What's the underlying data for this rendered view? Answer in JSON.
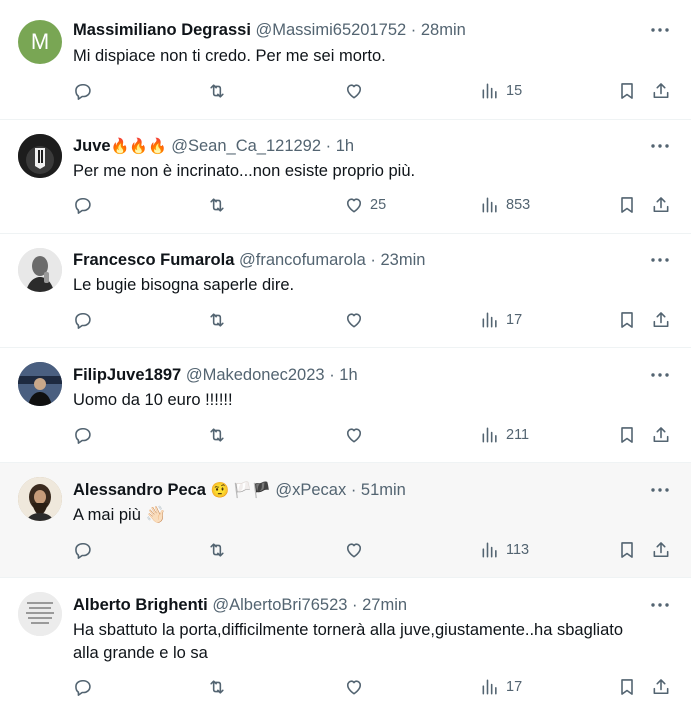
{
  "tweets": [
    {
      "avatar_letter": "M",
      "name": "Massimiliano Degrassi",
      "emoji": "",
      "handle": "@Massimi65201752",
      "sep": "·",
      "time": "28min",
      "text": "Mi dispiace non ti credo. Per me sei morto.",
      "likes": "",
      "views": "15"
    },
    {
      "avatar_letter": "",
      "name": "Juve",
      "emoji": "🔥🔥🔥",
      "handle": "@Sean_Ca_121292",
      "sep": "·",
      "time": "1h",
      "text": "Per me non è incrinato...non esiste proprio più.",
      "likes": "25",
      "views": "853"
    },
    {
      "avatar_letter": "",
      "name": "Francesco Fumarola",
      "emoji": "",
      "handle": "@francofumarola",
      "sep": "·",
      "time": "23min",
      "text": "Le bugie bisogna saperle dire.",
      "likes": "",
      "views": "17"
    },
    {
      "avatar_letter": "",
      "name": "FilipJuve1897",
      "emoji": "",
      "handle": "@Makedonec2023",
      "sep": "·",
      "time": "1h",
      "text": "Uomo da 10 euro !!!!!!",
      "likes": "",
      "views": "211"
    },
    {
      "avatar_letter": "",
      "name": "Alessandro Peca",
      "emoji": "🤨 🏳️🏴",
      "handle": "@xPecax",
      "sep": "·",
      "time": "51min",
      "text": "A mai più 👋🏻",
      "likes": "",
      "views": "113"
    },
    {
      "avatar_letter": "",
      "name": "Alberto Brighenti",
      "emoji": "",
      "handle": "@AlbertoBri76523",
      "sep": "·",
      "time": "27min",
      "text": "Ha sbattuto la porta,difficilmente tornerà alla juve,giustamente..ha sbagliato alla grande e lo sa",
      "likes": "",
      "views": "17"
    }
  ],
  "avatar_colors": {
    "letter_bg": "#79a654",
    "juve": "#1d1d1d",
    "francesco": "#d9d9d9",
    "filip": "#2a3a55",
    "alessandro": "#b8a37e",
    "alberto": "#e6e6e6"
  },
  "icons": {
    "more": "more-horizontal-icon",
    "reply": "reply-icon",
    "retweet": "retweet-icon",
    "like": "heart-icon",
    "views": "views-bar-chart-icon",
    "bookmark": "bookmark-icon",
    "share": "share-icon"
  }
}
